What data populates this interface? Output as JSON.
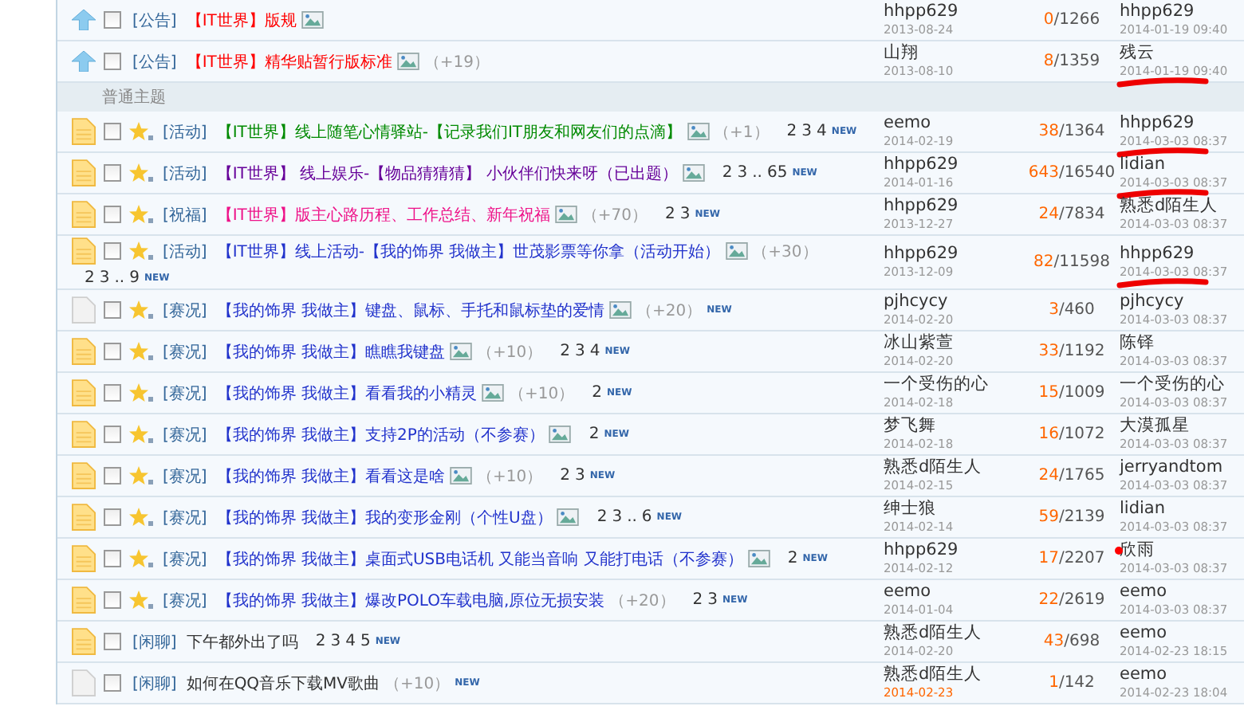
{
  "announcements": [
    {
      "kind": "announcement",
      "checked": false,
      "tag": "[公告]",
      "title": "【IT世界】版规",
      "color": "#ff0000",
      "image": true,
      "author": "hhpp629",
      "date": "2013-08-24",
      "date_hot": false,
      "replies": "0",
      "views": "/1266",
      "last": {
        "name": "hhpp629",
        "time": "2014-01-19 09:40",
        "marked": false,
        "dot": false
      }
    },
    {
      "kind": "announcement",
      "checked": false,
      "tag": "[公告]",
      "title": "【IT世界】精华贴暂行版标准",
      "color": "#ff0000",
      "image": true,
      "extra": "（+19）",
      "author": "山翔",
      "date": "2013-08-10",
      "date_hot": false,
      "replies": "8",
      "views": "/1359",
      "last": {
        "name": "残云",
        "time": "2014-01-19 09:40",
        "marked": true,
        "dot": false
      }
    }
  ],
  "section_label": "普通主题",
  "threads": [
    {
      "kind": "thread",
      "checked": false,
      "star": true,
      "tag": "[活动]",
      "title": "【IT世界】线上随笔心情驿站-【记录我们IT朋友和网友们的点滴】",
      "color": "#008a00",
      "image": true,
      "extra": "（+1）",
      "pages": [
        "2",
        "3",
        "4"
      ],
      "new": "NEW",
      "author": "eemo",
      "date": "2014-02-19",
      "date_hot": false,
      "replies": "38",
      "views": "/1364",
      "last": {
        "name": "hhpp629",
        "time": "2014-03-03 08:37",
        "marked": true,
        "dot": false
      }
    },
    {
      "kind": "thread",
      "checked": false,
      "star": true,
      "tag": "[活动]",
      "title": "【IT世界】 线上娱乐-【物品猜猜猜】 小伙伴们快来呀（已出题）",
      "color": "#660099",
      "image": true,
      "pages": [
        "2",
        "3",
        "..",
        "65"
      ],
      "new": "NEW",
      "author": "hhpp629",
      "date": "2014-01-16",
      "date_hot": false,
      "replies": "643",
      "views": "/16540",
      "last": {
        "name": "lidian",
        "time": "2014-03-03 08:37",
        "marked": true,
        "dot": false
      }
    },
    {
      "kind": "thread",
      "checked": false,
      "star": true,
      "tag": "[祝福]",
      "title": "【IT世界】版主心路历程、工作总结、新年祝福",
      "color": "#ee1188",
      "image": true,
      "extra": "（+70）",
      "pages": [
        "2",
        "3"
      ],
      "new": "NEW",
      "author": "hhpp629",
      "date": "2013-12-27",
      "date_hot": false,
      "replies": "24",
      "views": "/7834",
      "last": {
        "name": "熟悉d陌生人",
        "time": "2014-03-03 08:37",
        "marked": false,
        "dot": false
      }
    },
    {
      "kind": "thread",
      "checked": false,
      "star": true,
      "tag": "[活动]",
      "title": "【IT世界】线上活动-【我的饰界 我做主】世茂影票等你拿（活动开始）",
      "color": "#2233cc",
      "image": true,
      "extra": "（+30）",
      "pages": [
        "2",
        "3",
        "..",
        "9"
      ],
      "new": "NEW",
      "author": "hhpp629",
      "date": "2013-12-09",
      "date_hot": false,
      "replies": "82",
      "views": "/11598",
      "last": {
        "name": "hhpp629",
        "time": "2014-03-03 08:37",
        "marked": true,
        "dot": false
      }
    },
    {
      "kind": "thread_plain",
      "checked": false,
      "star": true,
      "tag": "[赛况]",
      "title": "【我的饰界 我做主】键盘、鼠标、手托和鼠标垫的爱情",
      "color": "#2233cc",
      "image": true,
      "extra": "（+20）",
      "new": "NEW",
      "author": "pjhcycy",
      "date": "2014-02-20",
      "date_hot": false,
      "replies": "3",
      "views": "/460",
      "last": {
        "name": "pjhcycy",
        "time": "2014-03-03 08:37",
        "marked": false,
        "dot": false
      }
    },
    {
      "kind": "thread",
      "checked": false,
      "star": true,
      "tag": "[赛况]",
      "title": "【我的饰界 我做主】瞧瞧我键盘",
      "color": "#2233cc",
      "image": true,
      "extra": "（+10）",
      "pages": [
        "2",
        "3",
        "4"
      ],
      "new": "NEW",
      "author": "冰山紫萱",
      "date": "2014-02-20",
      "date_hot": false,
      "replies": "33",
      "views": "/1192",
      "last": {
        "name": "陈铎",
        "time": "2014-03-03 08:37",
        "marked": false,
        "dot": false
      }
    },
    {
      "kind": "thread",
      "checked": false,
      "star": true,
      "tag": "[赛况]",
      "title": "【我的饰界 我做主】看看我的小精灵",
      "color": "#2233cc",
      "image": true,
      "extra": "（+10）",
      "pages": [
        "2"
      ],
      "new": "NEW",
      "author": "一个受伤的心",
      "date": "2014-02-18",
      "date_hot": false,
      "replies": "15",
      "views": "/1009",
      "last": {
        "name": "一个受伤的心",
        "time": "2014-03-03 08:37",
        "marked": false,
        "dot": false
      }
    },
    {
      "kind": "thread",
      "checked": false,
      "star": true,
      "tag": "[赛况]",
      "title": "【我的饰界 我做主】支持2P的活动（不参赛）",
      "color": "#2233cc",
      "image": true,
      "pages": [
        "2"
      ],
      "new": "NEW",
      "author": "梦飞舞",
      "date": "2014-02-18",
      "date_hot": false,
      "replies": "16",
      "views": "/1072",
      "last": {
        "name": "大漠孤星",
        "time": "2014-03-03 08:37",
        "marked": false,
        "dot": false
      }
    },
    {
      "kind": "thread",
      "checked": false,
      "star": true,
      "tag": "[赛况]",
      "title": "【我的饰界 我做主】看看这是啥",
      "color": "#2233cc",
      "image": true,
      "extra": "（+10）",
      "pages": [
        "2",
        "3"
      ],
      "new": "NEW",
      "author": "熟悉d陌生人",
      "date": "2014-02-15",
      "date_hot": false,
      "replies": "24",
      "views": "/1765",
      "last": {
        "name": "jerryandtom",
        "time": "2014-03-03 08:37",
        "marked": false,
        "dot": false
      }
    },
    {
      "kind": "thread",
      "checked": false,
      "star": true,
      "tag": "[赛况]",
      "title": "【我的饰界 我做主】我的变形金刚（个性U盘）",
      "color": "#2233cc",
      "image": true,
      "pages": [
        "2",
        "3",
        "..",
        "6"
      ],
      "new": "NEW",
      "author": "绅士狼",
      "date": "2014-02-14",
      "date_hot": false,
      "replies": "59",
      "views": "/2139",
      "last": {
        "name": "lidian",
        "time": "2014-03-03 08:37",
        "marked": false,
        "dot": false
      }
    },
    {
      "kind": "thread",
      "checked": false,
      "star": true,
      "tag": "[赛况]",
      "title": "【我的饰界 我做主】桌面式USB电话机 又能当音响 又能打电话（不参赛）",
      "color": "#2233cc",
      "image": true,
      "pages": [
        "2"
      ],
      "new": "NEW",
      "author": "hhpp629",
      "date": "2014-02-12",
      "date_hot": false,
      "replies": "17",
      "views": "/2207",
      "last": {
        "name": "欣雨",
        "time": "2014-03-03 08:37",
        "marked": false,
        "dot": true
      }
    },
    {
      "kind": "thread",
      "checked": false,
      "star": true,
      "tag": "[赛况]",
      "title": "【我的饰界 我做主】爆改POLO车载电脑,原位无损安装",
      "color": "#2233cc",
      "image": false,
      "extra": "（+20）",
      "pages": [
        "2",
        "3"
      ],
      "new": "NEW",
      "author": "eemo",
      "date": "2014-01-04",
      "date_hot": false,
      "replies": "22",
      "views": "/2619",
      "last": {
        "name": "eemo",
        "time": "2014-03-03 08:37",
        "marked": false,
        "dot": false
      }
    },
    {
      "kind": "thread",
      "checked": false,
      "star": false,
      "tag": "[闲聊]",
      "title": "下午都外出了吗",
      "color": "#333333",
      "image": false,
      "pages": [
        "2",
        "3",
        "4",
        "5"
      ],
      "new": "NEW",
      "author": "熟悉d陌生人",
      "date": "2014-02-20",
      "date_hot": false,
      "replies": "43",
      "views": "/698",
      "last": {
        "name": "eemo",
        "time": "2014-02-23 18:15",
        "marked": false,
        "dot": false
      }
    },
    {
      "kind": "thread_plain",
      "checked": false,
      "star": false,
      "tag": "[闲聊]",
      "title": "如何在QQ音乐下载MV歌曲",
      "color": "#333333",
      "image": false,
      "extra": "（+10）",
      "new": "NEW",
      "author": "熟悉d陌生人",
      "date": "2014-02-23",
      "date_hot": true,
      "replies": "1",
      "views": "/142",
      "last": {
        "name": "eemo",
        "time": "2014-02-23 18:04",
        "marked": false,
        "dot": false
      }
    }
  ]
}
